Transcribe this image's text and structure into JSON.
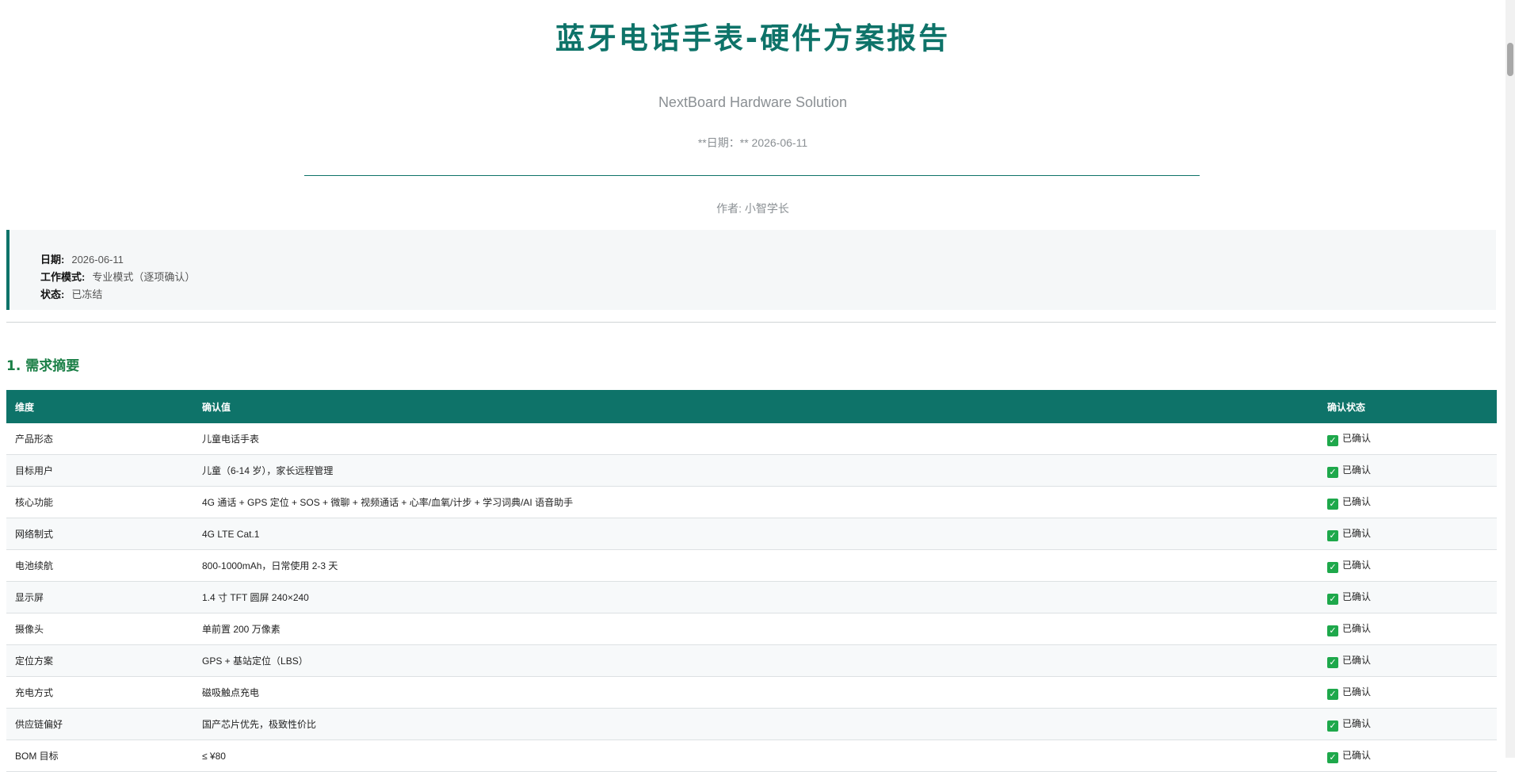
{
  "header": {
    "title": "蓝牙电话手表-硬件方案报告",
    "subtitle": "NextBoard Hardware Solution",
    "date_line": "**日期：** 2026-06-11",
    "author_line": "作者: 小智学长"
  },
  "info": [
    {
      "label": "日期:",
      "value": "2026-06-11"
    },
    {
      "label": "工作模式:",
      "value": "专业模式（逐项确认）"
    },
    {
      "label": "状态:",
      "value": "已冻结"
    }
  ],
  "section1": {
    "title": "1. 需求摘要",
    "headers": [
      "维度",
      "确认值",
      "确认状态"
    ],
    "rows": [
      {
        "dim": "产品形态",
        "value": "儿童电话手表",
        "status": "已确认"
      },
      {
        "dim": "目标用户",
        "value": "儿童（6-14 岁），家长远程管理",
        "status": "已确认"
      },
      {
        "dim": "核心功能",
        "value": "4G 通话 + GPS 定位 + SOS + 微聊 + 视频通话 + 心率/血氧/计步 + 学习词典/AI 语音助手",
        "status": "已确认"
      },
      {
        "dim": "网络制式",
        "value": "4G LTE Cat.1",
        "status": "已确认"
      },
      {
        "dim": "电池续航",
        "value": "800-1000mAh，日常使用 2-3 天",
        "status": "已确认"
      },
      {
        "dim": "显示屏",
        "value": "1.4 寸 TFT 圆屏 240×240",
        "status": "已确认"
      },
      {
        "dim": "摄像头",
        "value": "单前置 200 万像素",
        "status": "已确认"
      },
      {
        "dim": "定位方案",
        "value": "GPS + 基站定位（LBS）",
        "status": "已确认"
      },
      {
        "dim": "充电方式",
        "value": "磁吸触点充电",
        "status": "已确认"
      },
      {
        "dim": "供应链偏好",
        "value": "国产芯片优先，极致性价比",
        "status": "已确认"
      },
      {
        "dim": "BOM 目标",
        "value": "≤ ¥80",
        "status": "已确认"
      }
    ]
  }
}
